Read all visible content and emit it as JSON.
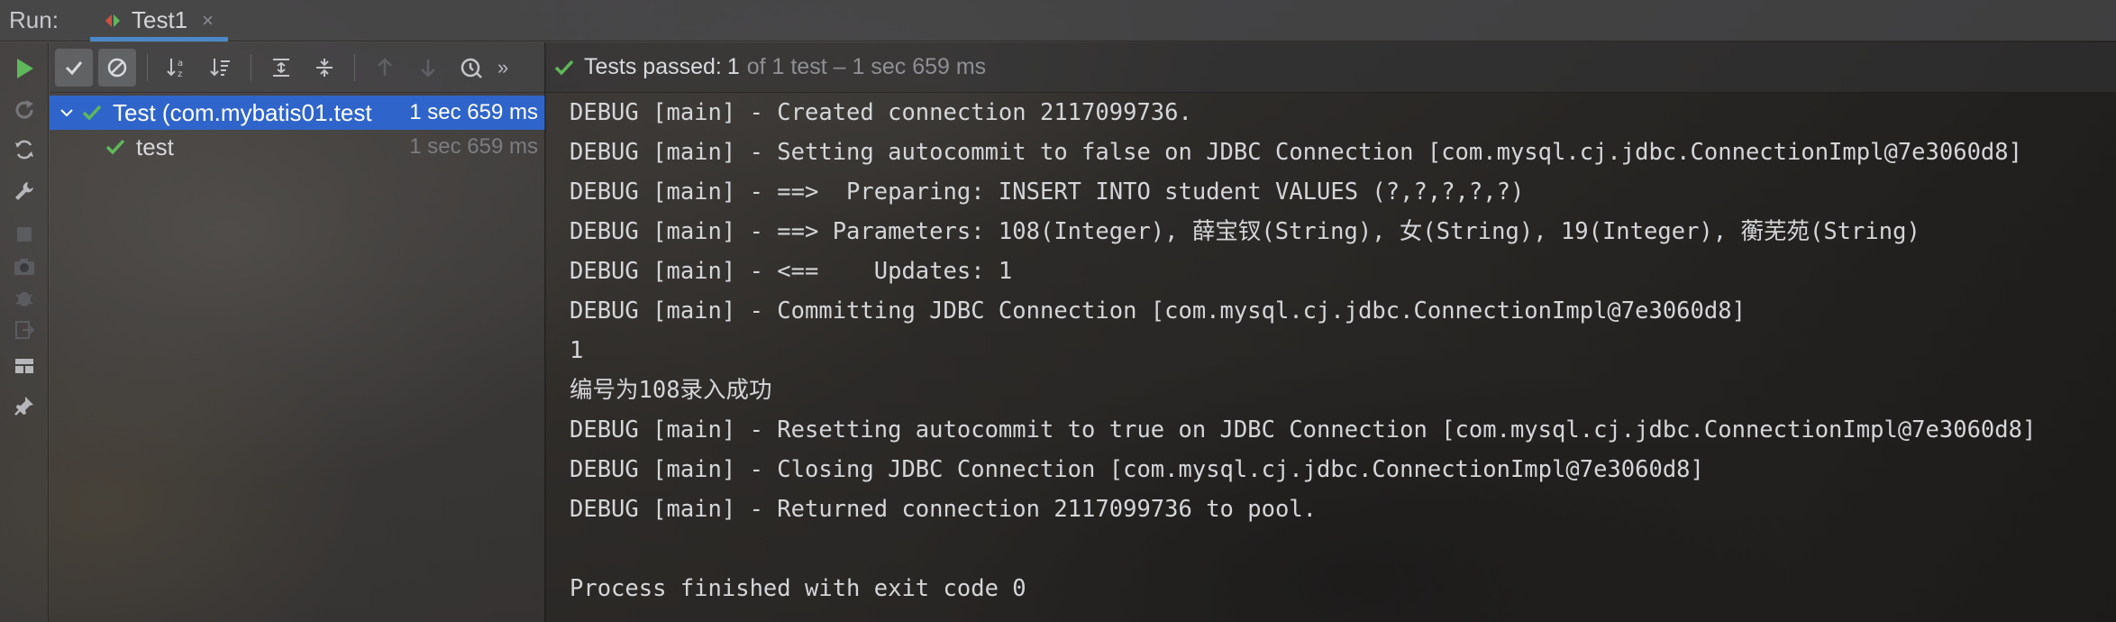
{
  "run_bar": {
    "label": "Run:",
    "tab_title": "Test1",
    "tab_close": "×"
  },
  "left_toolbar": {
    "icons": [
      "rerun-icon",
      "rerun-failed-icon",
      "toggle-auto-test-icon",
      "settings-wrench-icon",
      "stop-icon",
      "camera-icon",
      "debug-icon",
      "exit-icon",
      "layout-icon",
      "pin-icon"
    ]
  },
  "tree_toolbar": {
    "icons": [
      "show-passed-icon",
      "show-ignored-icon",
      "sort-alpha-icon",
      "sort-duration-icon",
      "expand-all-icon",
      "collapse-all-icon",
      "prev-failed-icon",
      "next-failed-icon",
      "history-icon"
    ],
    "more": "»"
  },
  "tree": {
    "root": {
      "name": "Test (com.mybatis01.test",
      "time": "1 sec 659 ms"
    },
    "child": {
      "name": "test",
      "time": "1 sec 659 ms"
    }
  },
  "status": {
    "passed": "Tests passed:",
    "count": "1",
    "rest": "of 1 test – 1 sec 659 ms"
  },
  "console": {
    "lines": [
      "DEBUG [main] - Created connection 2117099736.",
      "DEBUG [main] - Setting autocommit to false on JDBC Connection [com.mysql.cj.jdbc.ConnectionImpl@7e3060d8]",
      "DEBUG [main] - ==>  Preparing: INSERT INTO student VALUES (?,?,?,?,?)",
      "DEBUG [main] - ==> Parameters: 108(Integer), 薛宝钗(String), 女(String), 19(Integer), 蘅芜苑(String)",
      "DEBUG [main] - <==    Updates: 1",
      "DEBUG [main] - Committing JDBC Connection [com.mysql.cj.jdbc.ConnectionImpl@7e3060d8]",
      "1",
      "编号为108录入成功",
      "DEBUG [main] - Resetting autocommit to true on JDBC Connection [com.mysql.cj.jdbc.ConnectionImpl@7e3060d8]",
      "DEBUG [main] - Closing JDBC Connection [com.mysql.cj.jdbc.ConnectionImpl@7e3060d8]",
      "DEBUG [main] - Returned connection 2117099736 to pool.",
      "",
      "Process finished with exit code 0"
    ]
  },
  "colors": {
    "accent": "#4a88c7",
    "selection": "#2f65ca",
    "pass_green": "#5fb85a"
  }
}
